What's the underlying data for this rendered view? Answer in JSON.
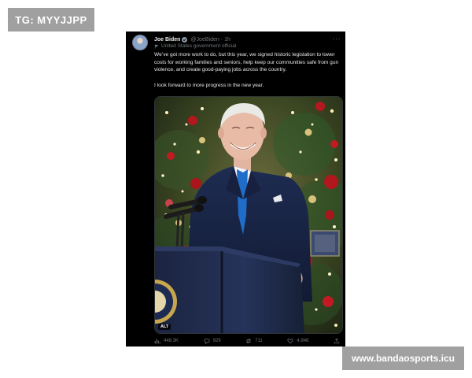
{
  "tag": {
    "label": "TG: MYYJJPP"
  },
  "watermark": {
    "text": "www.bandaosports.icu"
  },
  "tweet": {
    "author_name": "Joe Biden",
    "author_handle": "@JoeBiden",
    "separator": "·",
    "time": "1h",
    "affiliation": "United States government official",
    "body_paragraphs": [
      "We’ve got more work to do, but this year, we signed historic legislation to lower costs for working families and seniors, help keep our communities safe from gun violence, and create good-paying jobs across the country.",
      "I look forward to more progress in the new year."
    ],
    "media_alt_badge": "ALT",
    "stats": {
      "views": "448.3K",
      "replies": "929",
      "retweets": "711",
      "likes": "4,948"
    }
  },
  "colors": {
    "background": "#ffffff",
    "tweet_background": "#000000",
    "label_gray": "#a0a0a0",
    "secondary_text": "#71767b"
  }
}
